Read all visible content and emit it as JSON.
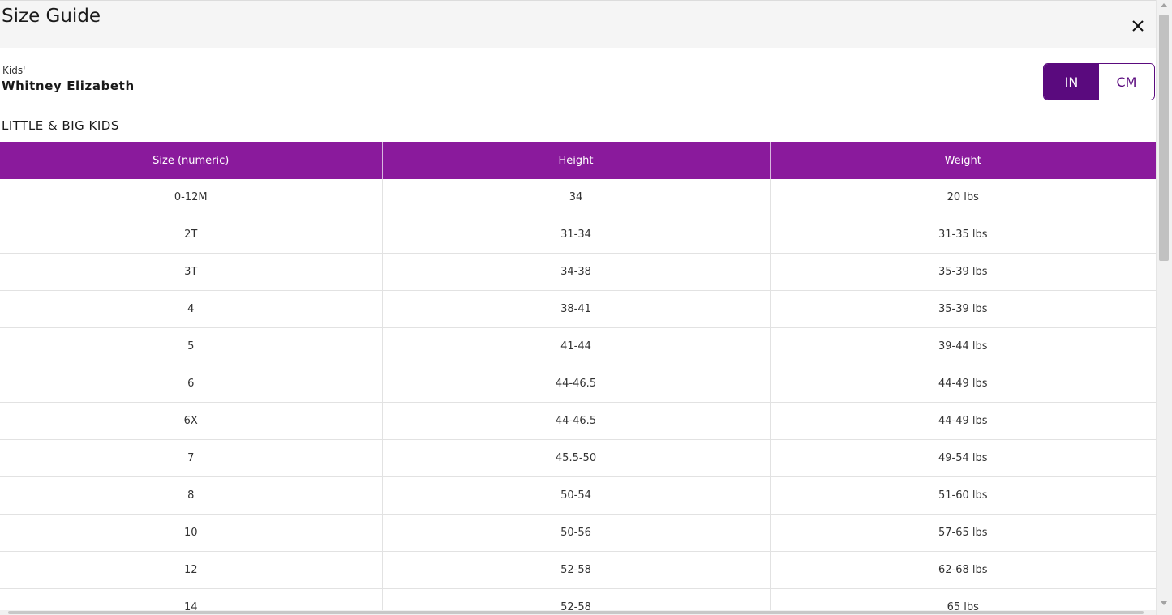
{
  "modal": {
    "title": "Size Guide",
    "close_icon": "close-icon"
  },
  "product": {
    "category": "Kids'",
    "brand": "Whitney Elizabeth"
  },
  "section_title": "LITTLE & BIG KIDS",
  "unit_toggle": {
    "options": [
      "IN",
      "CM"
    ],
    "selected": "IN"
  },
  "colors": {
    "accent": "#5a0a7e",
    "header_bg": "#8a1a9c"
  },
  "table": {
    "headers": [
      "Size (numeric)",
      "Height",
      "Weight"
    ],
    "rows": [
      [
        "0-12M",
        "34",
        "20 lbs"
      ],
      [
        "2T",
        "31-34",
        "31-35 lbs"
      ],
      [
        "3T",
        "34-38",
        "35-39 lbs"
      ],
      [
        "4",
        "38-41",
        "35-39 lbs"
      ],
      [
        "5",
        "41-44",
        "39-44 lbs"
      ],
      [
        "6",
        "44-46.5",
        "44-49 lbs"
      ],
      [
        "6X",
        "44-46.5",
        "44-49 lbs"
      ],
      [
        "7",
        "45.5-50",
        "49-54 lbs"
      ],
      [
        "8",
        "50-54",
        "51-60 lbs"
      ],
      [
        "10",
        "50-56",
        "57-65 lbs"
      ],
      [
        "12",
        "52-58",
        "62-68 lbs"
      ],
      [
        "14",
        "52-58",
        "65 lbs"
      ]
    ]
  }
}
